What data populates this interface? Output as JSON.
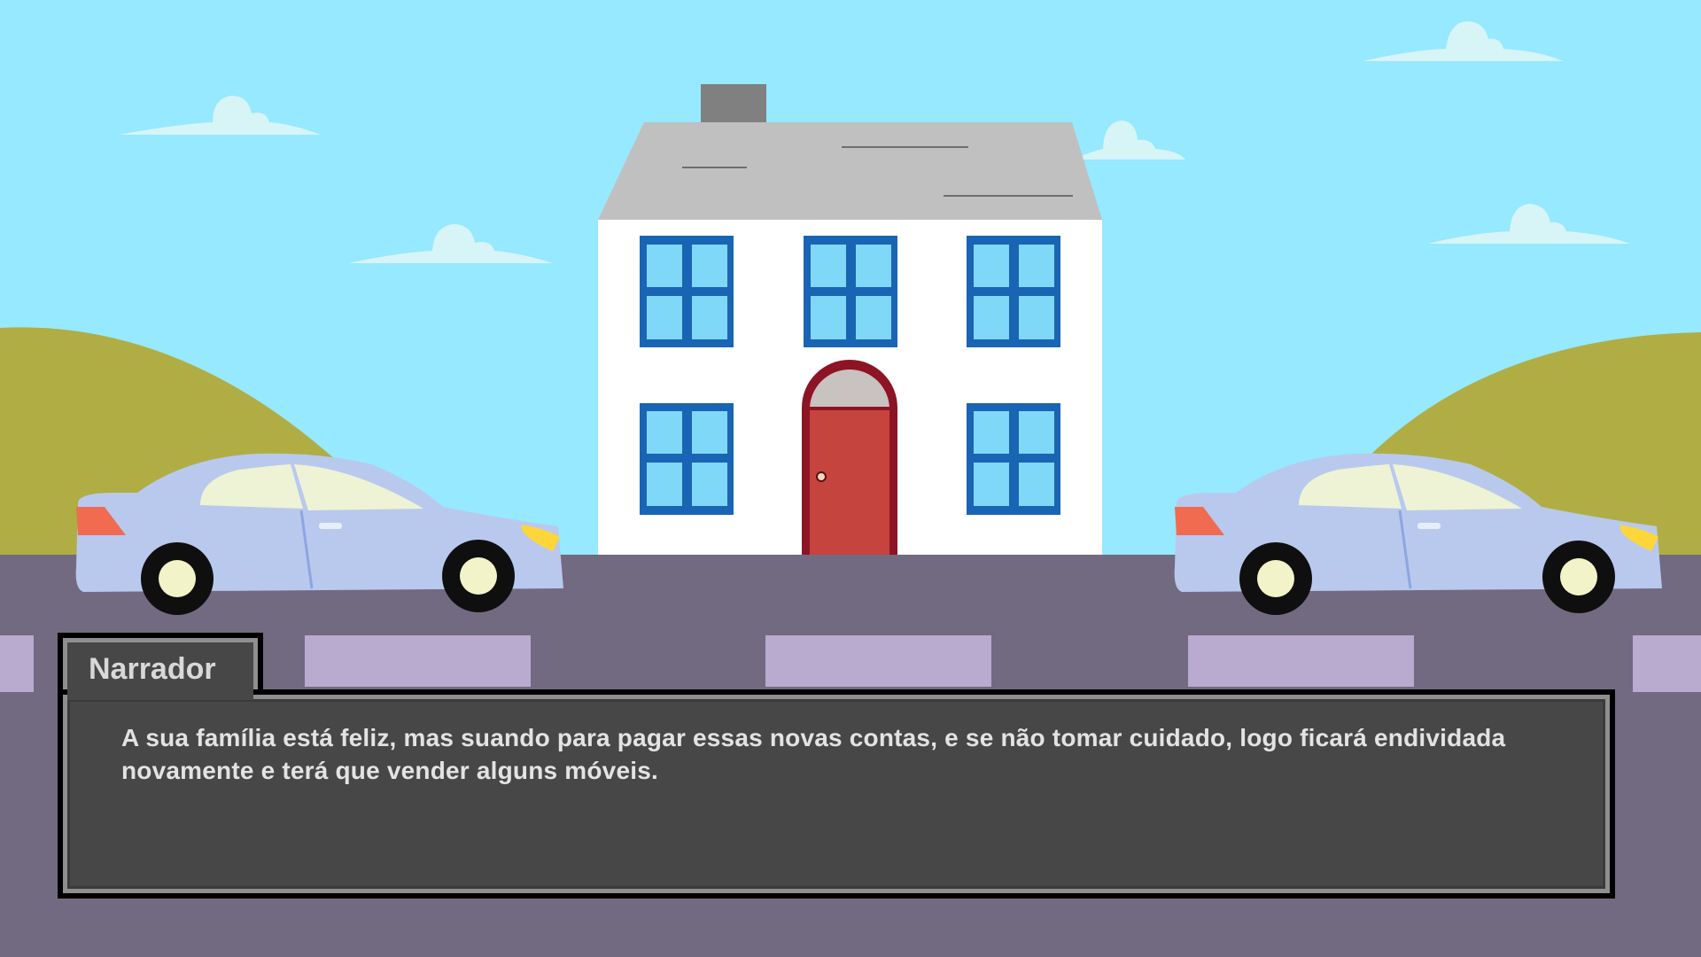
{
  "dialogue": {
    "speaker": "Narrador",
    "text": "A sua família está feliz, mas suando para pagar essas novas contas, e se não tomar cuidado, logo ficará endividada novamente e terá que vender alguns móveis."
  },
  "colors": {
    "sky": "#96e9fe",
    "hills": "#b0ad45",
    "road": "#726a80",
    "road_marks": "#b9aad0",
    "house_wall": "#ffffff",
    "roof": "#c0c0c0",
    "chimney": "#808080",
    "window_frame": "#1a64b4",
    "window_glass": "#7fd8f8",
    "door": "#c6443e",
    "door_frame": "#8d1424",
    "car_body": "#b9c9ee",
    "car_glass": "#eef3d5",
    "headlight": "#fdd63a",
    "taillight": "#f06b50",
    "dialogue_bg": "#474747",
    "dialogue_border": "#8f8f8f",
    "dialogue_text": "#e3e3e3"
  }
}
